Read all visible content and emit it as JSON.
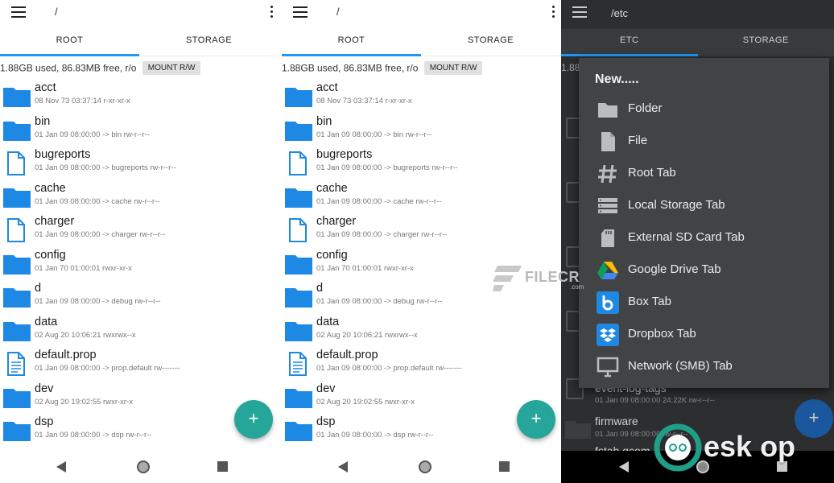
{
  "colors": {
    "accent": "#2196f3",
    "folder": "#1e88e5",
    "fab": "#26a69a",
    "dark_bg": "#2d2e30",
    "menu_bg": "#424345"
  },
  "left": {
    "path": "/",
    "tabs": [
      "ROOT",
      "STORAGE"
    ],
    "active_tab": 0,
    "status": "1.88GB used, 86.83MB free, r/o",
    "mount_button": "MOUNT R/W",
    "files": [
      {
        "name": "acct",
        "meta": "08 Nov 73 03:37:14    r-xr-xr-x",
        "icon": "folder-icon"
      },
      {
        "name": "bin",
        "meta": "01 Jan 09 08:00:00  -> bin  rw-r--r--",
        "icon": "folder-icon"
      },
      {
        "name": "bugreports",
        "meta": "01 Jan 09 08:00:00  -> bugreports  rw-r--r--",
        "icon": "file-icon"
      },
      {
        "name": "cache",
        "meta": "01 Jan 09 08:00:00  -> cache  rw-r--r--",
        "icon": "folder-icon"
      },
      {
        "name": "charger",
        "meta": "01 Jan 09 08:00:00  -> charger  rw-r--r--",
        "icon": "file-icon"
      },
      {
        "name": "config",
        "meta": "01 Jan 70 01:00:01    rwxr-xr-x",
        "icon": "folder-icon"
      },
      {
        "name": "d",
        "meta": "01 Jan 09 08:00:00  -> debug  rw-r--r--",
        "icon": "folder-icon"
      },
      {
        "name": "data",
        "meta": "02 Aug 20 10:06:21    rwxrwx--x",
        "icon": "folder-icon"
      },
      {
        "name": "default.prop",
        "meta": "01 Jan 09 08:00:00  -> prop.default  rw-------",
        "icon": "text-file-icon"
      },
      {
        "name": "dev",
        "meta": "02 Aug 20 19:02:55    rwxr-xr-x",
        "icon": "folder-icon"
      },
      {
        "name": "dsp",
        "meta": "01 Jan 09 08:00:00  -> dsp  rw-r--r--",
        "icon": "folder-icon"
      }
    ]
  },
  "right": {
    "path": "/etc",
    "tabs": [
      "ETC",
      "STORAGE"
    ],
    "status_fragment": "1.88",
    "bg_files": [
      {
        "name": "event-log-tags",
        "meta": "01 Jan 09 08:00:00    24.22K  rw-r--r--"
      },
      {
        "name": "firmware",
        "meta": "01 Jan 09 08:00:00    rw-r--r--"
      },
      {
        "name": "fstab.qcom"
      }
    ],
    "menu": {
      "title": "New.....",
      "items": [
        {
          "label": "Folder",
          "icon": "folder-icon"
        },
        {
          "label": "File",
          "icon": "file-icon"
        },
        {
          "label": "Root Tab",
          "icon": "hash-icon"
        },
        {
          "label": "Local Storage Tab",
          "icon": "storage-icon"
        },
        {
          "label": "External SD Card Tab",
          "icon": "sd-card-icon"
        },
        {
          "label": "Google Drive Tab",
          "icon": "google-drive-icon"
        },
        {
          "label": "Box Tab",
          "icon": "box-icon"
        },
        {
          "label": "Dropbox Tab",
          "icon": "dropbox-icon"
        },
        {
          "label": "Network (SMB) Tab",
          "icon": "monitor-icon"
        }
      ]
    }
  },
  "fab_symbol": "+",
  "watermarks": {
    "filecr": "FILECR",
    "filecr_sub": ".com",
    "desktop": "esk op"
  }
}
